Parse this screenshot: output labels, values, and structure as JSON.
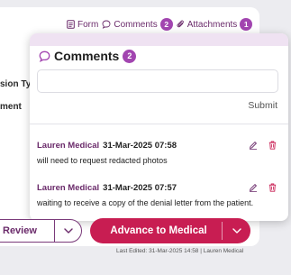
{
  "background": {
    "field_label_1": "sion Ty",
    "field_label_2": "ment"
  },
  "toplinks": {
    "form_label": "Form",
    "comments_label": "Comments",
    "comments_count": "2",
    "attachments_label": "Attachments",
    "attachments_count": "1"
  },
  "comments_panel": {
    "title": "Comments",
    "count": "2",
    "input_value": "",
    "input_placeholder": "",
    "submit_label": "Submit",
    "items": [
      {
        "author": "Lauren Medical",
        "timestamp": "31-Mar-2025 07:58",
        "text": "will need to request redacted photos"
      },
      {
        "author": "Lauren Medical",
        "timestamp": "31-Mar-2025 07:57",
        "text": "waiting to receive a copy of the denial letter from the patient."
      }
    ]
  },
  "actions": {
    "review_label": "Review",
    "advance_label": "Advance to Medical",
    "last_edited": "Last Edited: 31-Mar-2025 14:58 | Lauren Medical"
  },
  "colors": {
    "brand_purple": "#6a2a6a",
    "badge": "#a245b0",
    "advance": "#c81d52",
    "delete_icon": "#c81d52"
  }
}
